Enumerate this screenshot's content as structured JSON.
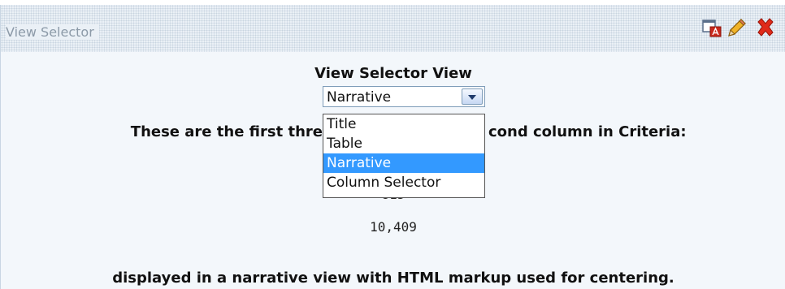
{
  "panel": {
    "title": "View Selector"
  },
  "toolbar": {
    "icons": [
      "copy-icon",
      "edit-pencil-icon",
      "close-icon"
    ]
  },
  "view": {
    "heading": "View Selector View",
    "selector": {
      "selected": "Narrative",
      "options": [
        "Title",
        "Table",
        "Narrative",
        "Column Selector"
      ],
      "highlighted_index": 2
    },
    "intro_left": "These are the first thre",
    "intro_right": "cond column in Criteria:",
    "values": [
      "815",
      "10,409"
    ],
    "footer_text": "displayed in a narrative view with HTML markup used for centering."
  },
  "colors": {
    "highlight": "#3399ff",
    "close_red": "#e02a1a",
    "panel_bg": "#f3f7fb"
  }
}
